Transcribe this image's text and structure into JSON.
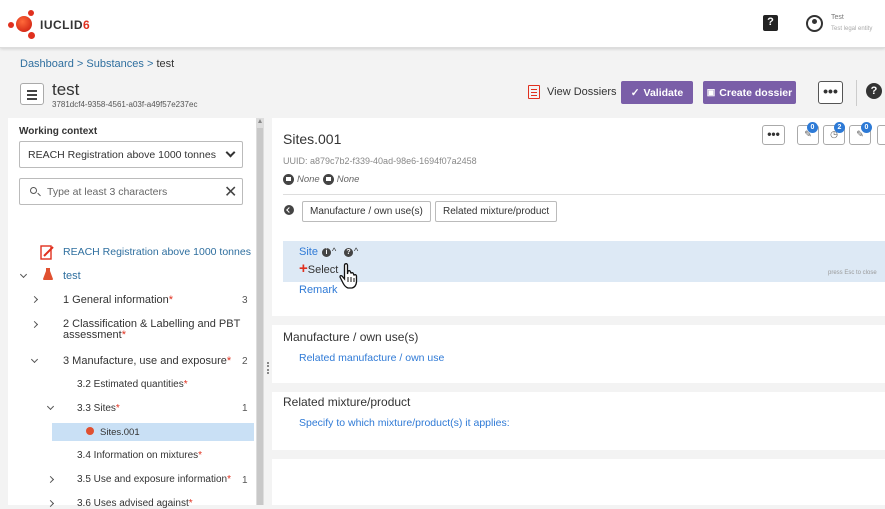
{
  "app": {
    "logo_text": "IUCLID",
    "logo_version": "6",
    "help_label": "?",
    "user_name": "Test",
    "user_entity": "Test legal entity"
  },
  "breadcrumb": {
    "dashboard": "Dashboard",
    "sep": ">",
    "substances": "Substances",
    "current": "test"
  },
  "header": {
    "title": "test",
    "uuid": "3781dcf4-9358-4561-a03f-a49f57e237ec",
    "view_dossiers": "View Dossiers",
    "validate": "Validate",
    "create_dossier": "Create dossier",
    "more": "•••",
    "help": "?"
  },
  "sidebar": {
    "working_context_label": "Working context",
    "working_context_value": "REACH Registration above 1000 tonnes",
    "search_placeholder": "Type at least 3 characters",
    "root_context": "REACH Registration above 1000 tonnes",
    "substance": "test",
    "required_mark": "*",
    "items": [
      {
        "label": "1 General information",
        "required": true,
        "count": "3"
      },
      {
        "label": "2 Classification & Labelling and PBT",
        "label2": "assessment",
        "required": true,
        "count": ""
      },
      {
        "label": "3 Manufacture, use and exposure",
        "required": true,
        "count": "2"
      },
      {
        "label": "3.2 Estimated quantities",
        "required": true,
        "count": ""
      },
      {
        "label": "3.3 Sites",
        "required": true,
        "count": "1"
      },
      {
        "label": "Sites.001",
        "required": false,
        "count": ""
      },
      {
        "label": "3.4 Information on mixtures",
        "required": true,
        "count": ""
      },
      {
        "label": "3.5 Use and exposure information",
        "required": true,
        "count": "1"
      },
      {
        "label": "3.6 Uses advised against",
        "required": true,
        "count": ""
      }
    ]
  },
  "document": {
    "title": "Sites.001",
    "uuid": "UUID: a879c7b2-f339-40ad-98e6-1694f07a2458",
    "none1": "None",
    "none2": "None",
    "more": "•••",
    "badges": [
      "0",
      "2",
      "0"
    ],
    "tabs": [
      "Manufacture / own use(s)",
      "Related mixture/product"
    ],
    "site_label": "Site",
    "select_label": "Select",
    "plus": "+",
    "esc_hint": "press Esc to close",
    "remark": "Remark",
    "sections": [
      {
        "title": "Manufacture / own use(s)",
        "link": "Related manufacture / own use"
      },
      {
        "title": "Related mixture/product",
        "link": "Specify to which mixture/product(s) it applies:"
      }
    ]
  },
  "colors": {
    "accent_purple": "#7a5ea8",
    "link_blue": "#2f7ad6",
    "required_red": "#e0301e",
    "selection_blue": "#c9e0f5"
  }
}
